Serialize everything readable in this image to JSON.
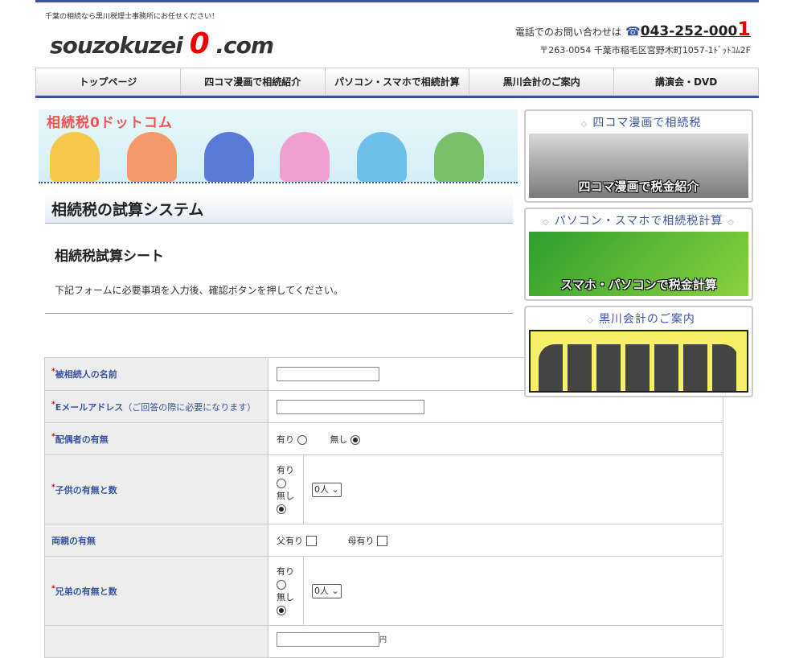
{
  "header": {
    "tagline": "千葉の相続なら黒川税理士事務所にお任せください！",
    "logo_left": "souzokuzei",
    "logo_zero": "0",
    "logo_right": ".com",
    "phone_label": "電話でのお問い合わせは",
    "phone_icon": "☎",
    "phone_number": "043-252-000",
    "phone_last": "1",
    "address": "〒263-0054 千葉市稲毛区宮野木町1057-1ﾄﾞｯﾄｺﾑ2F"
  },
  "nav": [
    {
      "label": "トップページ"
    },
    {
      "label": "四コマ漫画で相続紹介"
    },
    {
      "label": "パソコン・スマホで相続計算"
    },
    {
      "label": "黒川会計のご案内"
    },
    {
      "label": "講演会・DVD"
    }
  ],
  "banner": {
    "title": "相続税0ドットコム"
  },
  "main": {
    "title": "相続税の試算システム",
    "subtitle": "相続税試算シート",
    "instruction": "下記フォームに必要事項を入力後、確認ボタンを押してください。"
  },
  "form": {
    "required_mark": "*",
    "decedent_name": {
      "label": "被相続人の名前"
    },
    "email": {
      "label": "Eメールアドレス",
      "note": "（ご回答の際に必要になります）"
    },
    "spouse": {
      "label": "配偶者の有無",
      "yes": "有り",
      "no": "無し",
      "selected": "no"
    },
    "children": {
      "label": "子供の有無と数",
      "yes": "有り",
      "no": "無し",
      "selected": "no",
      "count": "0人"
    },
    "parents": {
      "label": "両親の有無",
      "father": "父有り",
      "mother": "母有り"
    },
    "siblings": {
      "label": "兄弟の有無と数",
      "yes": "有り",
      "no": "無し",
      "selected": "no",
      "count": "0人"
    },
    "last_row_suffix": "円"
  },
  "sidebar": [
    {
      "title": "四コマ漫画で相続税",
      "caption": "四コマ漫画で税金紹介",
      "bg": "#6b6b6b"
    },
    {
      "title": "パソコン・スマホで相続税計算",
      "caption": "スマホ・パソコンで税金計算",
      "bg": "#3fb23f"
    },
    {
      "title": "黒川会計のご案内",
      "caption": "",
      "bg": "#f5ef6a"
    }
  ],
  "colors": {
    "accent": "#3a53a0",
    "brand_red": "#e00000"
  }
}
